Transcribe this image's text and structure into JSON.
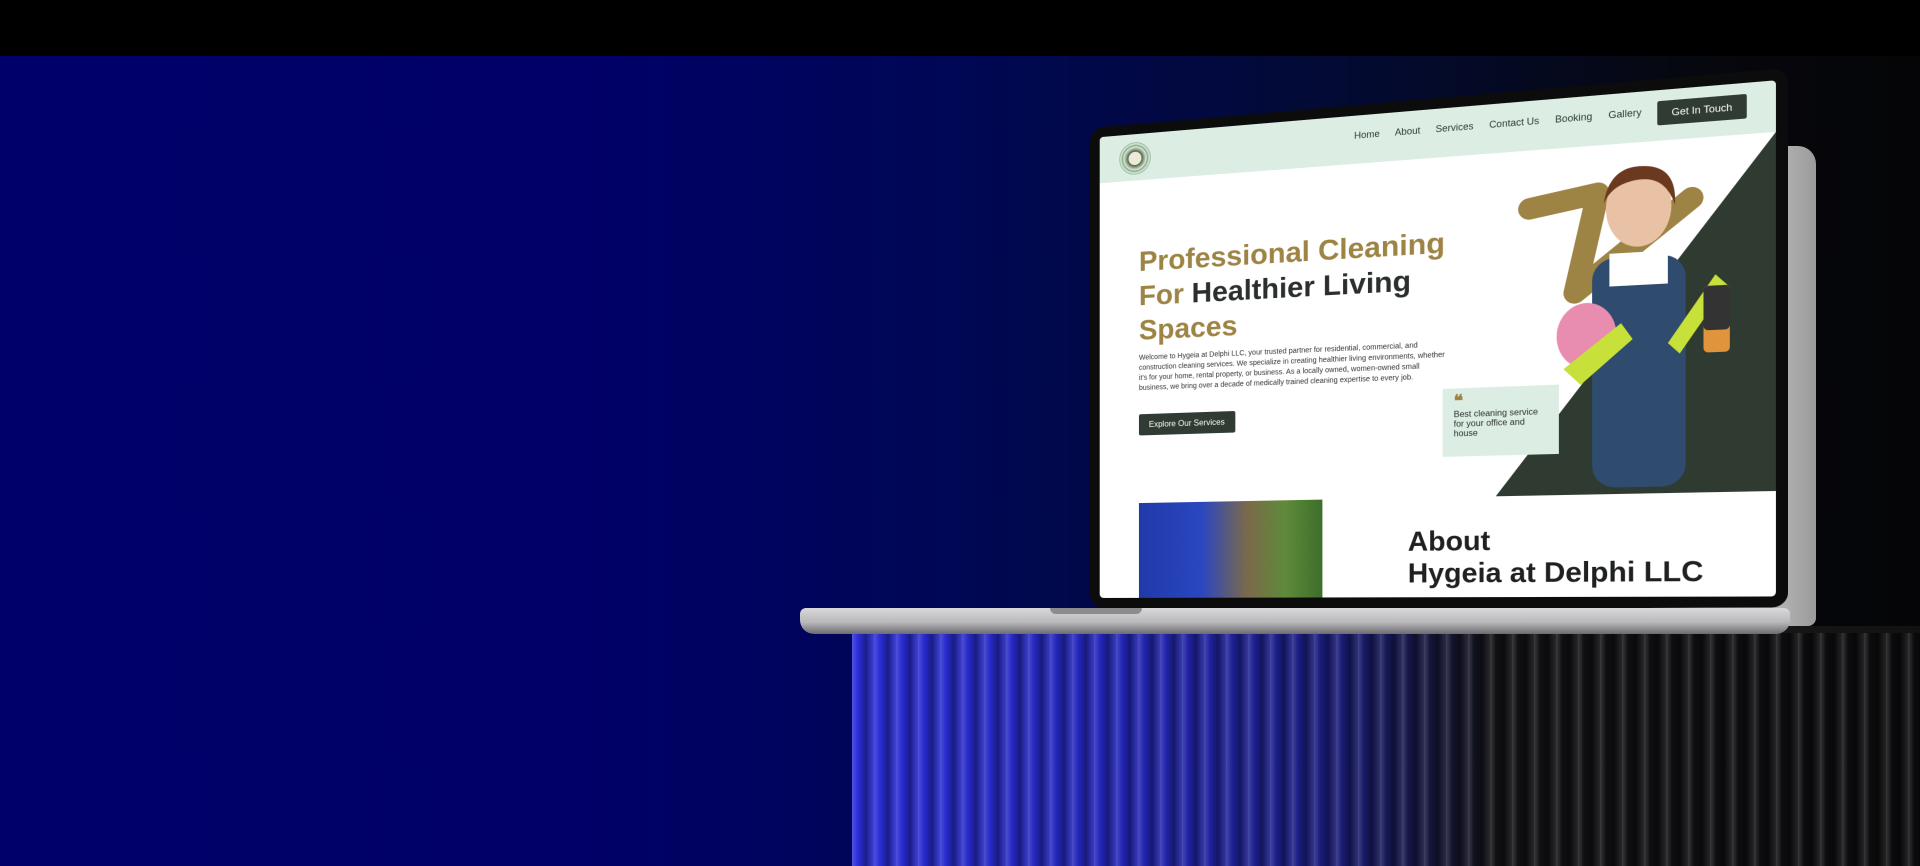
{
  "nav": {
    "links": [
      "Home",
      "About",
      "Services",
      "Contact Us",
      "Booking",
      "Gallery"
    ],
    "cta": "Get In Touch"
  },
  "hero": {
    "title_gold_1": "Professional Cleaning",
    "title_gold_2": "For",
    "title_dark_2": "Healthier Living",
    "title_gold_3": "Spaces",
    "description": "Welcome to Hygeia at Delphi LLC, your trusted partner for residential, commercial, and construction cleaning services. We specialize in creating healthier living environments, whether it's for your home, rental property, or business. As a locally owned, women-owned small business, we bring over a decade of medically trained cleaning expertise to every job.",
    "button": "Explore Our Services",
    "quote_mark": "❝",
    "quote_text": "Best cleaning service for your office and house"
  },
  "about": {
    "title_line1": "About",
    "title_line2": "Hygeia at Delphi LLC"
  },
  "colors": {
    "accent_gold": "#9d8344",
    "dark_green": "#2f3b33",
    "mint": "#dceee4"
  }
}
